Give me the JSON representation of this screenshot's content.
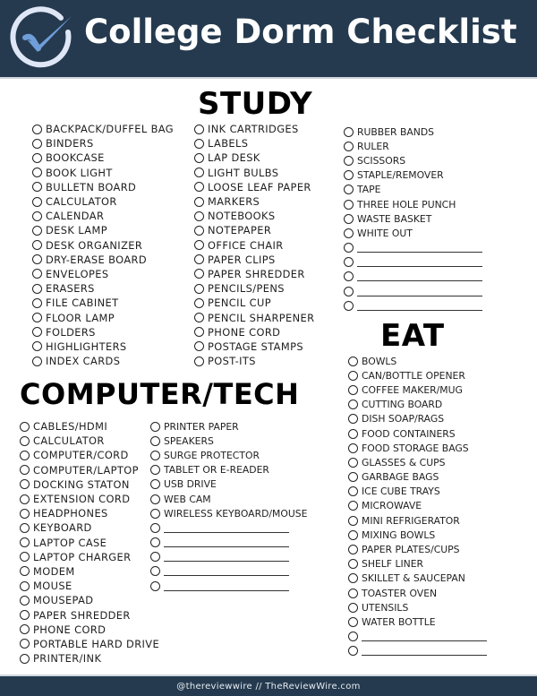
{
  "header": {
    "title": "College Dorm Checklist",
    "icon": "check-circle-icon",
    "colors": {
      "background": "#253a4f",
      "ring": "#dfe7f6",
      "check": "#6f9ed8"
    }
  },
  "sections": {
    "study": {
      "title": "STUDY",
      "columns": [
        [
          "BACKPACK/DUFFEL BAG",
          "BINDERS",
          "BOOKCASE",
          "BOOK LIGHT",
          "BULLETN BOARD",
          "CALCULATOR",
          "CALENDAR",
          "DESK LAMP",
          "DESK ORGANIZER",
          "DRY-ERASE BOARD",
          "ENVELOPES",
          "ERASERS",
          "FILE CABINET",
          "FLOOR LAMP",
          "FOLDERS",
          "HIGHLIGHTERS",
          "INDEX CARDS"
        ],
        [
          "INK CARTRIDGES",
          "LABELS",
          "LAP DESK",
          "LIGHT BULBS",
          "LOOSE LEAF PAPER",
          "MARKERS",
          "NOTEBOOKS",
          "NOTEPAPER",
          "OFFICE CHAIR",
          "PAPER CLIPS",
          "PAPER SHREDDER",
          "PENCILS/PENS",
          "PENCIL CUP",
          "PENCIL SHARPENER",
          "PHONE CORD",
          "POSTAGE STAMPS",
          "POST-ITS"
        ],
        [
          "RUBBER BANDS",
          "RULER",
          "SCISSORS",
          "STAPLE/REMOVER",
          "TAPE",
          "THREE HOLE PUNCH",
          "WASTE BASKET",
          "WHITE OUT",
          "",
          "",
          "",
          "",
          ""
        ]
      ]
    },
    "tech": {
      "title": "COMPUTER/TECH",
      "columns": [
        [
          "CABLES/HDMI",
          "CALCULATOR",
          "COMPUTER/CORD",
          "COMPUTER/LAPTOP",
          "DOCKING STATON",
          "EXTENSION CORD",
          "HEADPHONES",
          "KEYBOARD",
          "LAPTOP CASE",
          "LAPTOP CHARGER",
          "MODEM",
          "MOUSE",
          "MOUSEPAD",
          "PAPER SHREDDER",
          "PHONE CORD",
          "PORTABLE HARD DRIVE",
          "PRINTER/INK"
        ],
        [
          "PRINTER PAPER",
          "SPEAKERS",
          "SURGE PROTECTOR",
          "TABLET OR E-READER",
          "USB DRIVE",
          "WEB CAM",
          "WIRELESS KEYBOARD/MOUSE",
          "",
          "",
          "",
          "",
          ""
        ]
      ]
    },
    "eat": {
      "title": "EAT",
      "columns": [
        [
          "BOWLS",
          "CAN/BOTTLE OPENER",
          "COFFEE MAKER/MUG",
          "CUTTING BOARD",
          "DISH SOAP/RAGS",
          "FOOD CONTAINERS",
          "FOOD STORAGE BAGS",
          "GLASSES & CUPS",
          "GARBAGE BAGS",
          "ICE CUBE TRAYS",
          "MICROWAVE",
          "MINI REFRIGERATOR",
          "MIXING BOWLS",
          "PAPER PLATES/CUPS",
          "SHELF LINER",
          "SKILLET & SAUCEPAN",
          "TOASTER OVEN",
          "UTENSILS",
          "WATER BOTTLE",
          "",
          ""
        ]
      ]
    }
  },
  "footer": {
    "text": "@thereviewwire // TheReviewWire.com"
  }
}
